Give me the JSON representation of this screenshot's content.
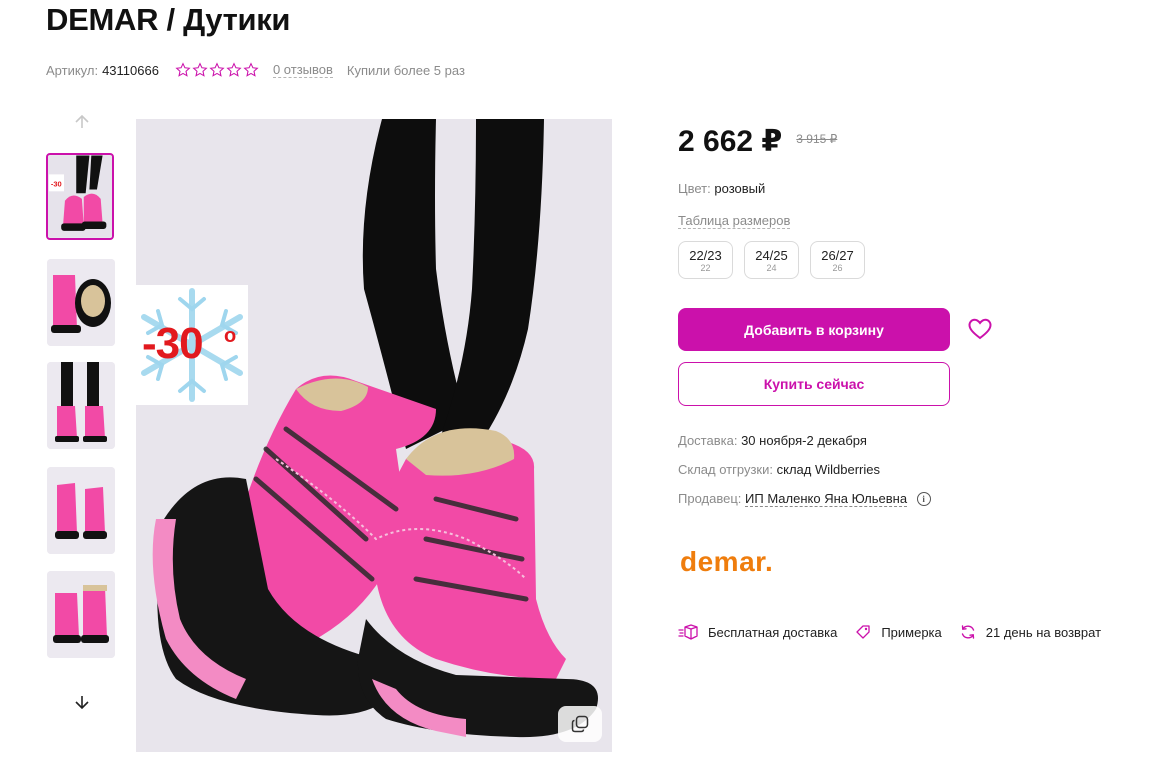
{
  "product": {
    "title": "DEMAR / Дутики",
    "sku_label": "Артикул:",
    "sku_value": "43110666",
    "rating_stars": 0,
    "reviews": "0 отзывов",
    "bought": "Купили более 5 раз"
  },
  "gallery": {
    "badge_text": "-30",
    "badge_degree": "o",
    "thumbnails": [
      "thumb-1",
      "thumb-2",
      "thumb-3",
      "thumb-4",
      "thumb-5"
    ],
    "active_index": 0
  },
  "price": {
    "current": "2 662 ₽",
    "old": "3 915 ₽"
  },
  "color": {
    "label": "Цвет:",
    "value": "розовый"
  },
  "size_table_link": "Таблица размеров",
  "sizes": [
    {
      "label": "22/23",
      "sub": "22"
    },
    {
      "label": "24/25",
      "sub": "24"
    },
    {
      "label": "26/27",
      "sub": "26"
    }
  ],
  "actions": {
    "add_to_cart": "Добавить в корзину",
    "buy_now": "Купить сейчас"
  },
  "delivery": {
    "delivery_label": "Доставка:",
    "delivery_value": "30 ноября-2 декабря",
    "warehouse_label": "Склад отгрузки:",
    "warehouse_value": "склад Wildberries",
    "seller_label": "Продавец:",
    "seller_value": "ИП Маленко Яна Юльевна"
  },
  "brand_logo": "demar.",
  "features": [
    {
      "icon": "box-icon",
      "label": "Бесплатная доставка"
    },
    {
      "icon": "tag-icon",
      "label": "Примерка"
    },
    {
      "icon": "refresh-icon",
      "label": "21 день на возврат"
    }
  ],
  "colors": {
    "accent": "#cb11ab",
    "brand_orange": "#ef7d0d",
    "discount_red": "#e2191e",
    "boot_pink": "#f24aa6"
  }
}
